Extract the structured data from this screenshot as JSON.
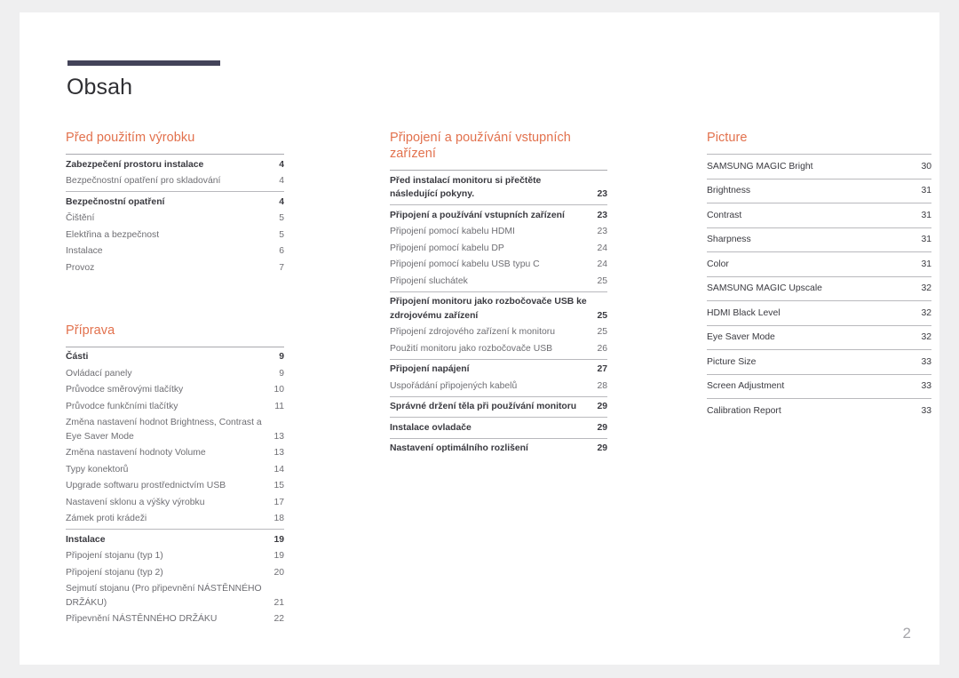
{
  "document": {
    "title": "Obsah",
    "page_number": "2",
    "accent_color": "#e2714d",
    "rule_color": "#434359",
    "page_number_color": "#a6a6ab"
  },
  "columns": [
    {
      "name": "column-1",
      "sections": [
        {
          "title": "Před použitím výrobku",
          "groups": [
            {
              "entries": [
                {
                  "label": "Zabezpečení prostoru instalace",
                  "page": "4",
                  "level": "head"
                },
                {
                  "label": "Bezpečnostní opatření pro skladování",
                  "page": "4",
                  "level": "sub"
                }
              ]
            },
            {
              "entries": [
                {
                  "label": "Bezpečnostní opatření",
                  "page": "4",
                  "level": "head"
                },
                {
                  "label": "Čištění",
                  "page": "5",
                  "level": "sub"
                },
                {
                  "label": "Elektřina a bezpečnost",
                  "page": "5",
                  "level": "sub"
                },
                {
                  "label": "Instalace",
                  "page": "6",
                  "level": "sub"
                },
                {
                  "label": "Provoz",
                  "page": "7",
                  "level": "sub"
                }
              ]
            }
          ]
        },
        {
          "title": "Příprava",
          "groups": [
            {
              "entries": [
                {
                  "label": "Části",
                  "page": "9",
                  "level": "head"
                },
                {
                  "label": "Ovládací panely",
                  "page": "9",
                  "level": "sub"
                },
                {
                  "label": "Průvodce směrovými tlačítky",
                  "page": "10",
                  "level": "sub"
                },
                {
                  "label": "Průvodce funkčními tlačítky",
                  "page": "11",
                  "level": "sub"
                },
                {
                  "label": "Změna nastavení hodnot Brightness, Contrast a Eye Saver Mode",
                  "page": "13",
                  "level": "sub"
                },
                {
                  "label": "Změna nastavení hodnoty Volume",
                  "page": "13",
                  "level": "sub"
                },
                {
                  "label": "Typy konektorů",
                  "page": "14",
                  "level": "sub"
                },
                {
                  "label": "Upgrade softwaru prostřednictvím USB",
                  "page": "15",
                  "level": "sub"
                },
                {
                  "label": "Nastavení sklonu a výšky výrobku",
                  "page": "17",
                  "level": "sub"
                },
                {
                  "label": "Zámek proti krádeži",
                  "page": "18",
                  "level": "sub"
                }
              ]
            },
            {
              "entries": [
                {
                  "label": "Instalace",
                  "page": "19",
                  "level": "head"
                },
                {
                  "label": "Připojení stojanu (typ 1)",
                  "page": "19",
                  "level": "sub"
                },
                {
                  "label": "Připojení stojanu (typ 2)",
                  "page": "20",
                  "level": "sub"
                },
                {
                  "label": "Sejmutí stojanu (Pro připevnění NÁSTĚNNÉHO DRŽÁKU)",
                  "page": "21",
                  "level": "sub"
                },
                {
                  "label": "Připevnění NÁSTĚNNÉHO DRŽÁKU",
                  "page": "22",
                  "level": "sub"
                }
              ]
            }
          ]
        }
      ]
    },
    {
      "name": "column-2",
      "sections": [
        {
          "title": "Připojení a používání vstupních zařízení",
          "groups": [
            {
              "entries": [
                {
                  "label": "Před instalací monitoru si přečtěte následující pokyny.",
                  "page": "23",
                  "level": "head"
                }
              ]
            },
            {
              "entries": [
                {
                  "label": "Připojení a používání vstupních zařízení",
                  "page": "23",
                  "level": "head"
                },
                {
                  "label": "Připojení pomocí kabelu HDMI",
                  "page": "23",
                  "level": "sub"
                },
                {
                  "label": "Připojení pomocí kabelu DP",
                  "page": "24",
                  "level": "sub"
                },
                {
                  "label": "Připojení pomocí kabelu USB typu C",
                  "page": "24",
                  "level": "sub"
                },
                {
                  "label": "Připojení sluchátek",
                  "page": "25",
                  "level": "sub"
                }
              ]
            },
            {
              "entries": [
                {
                  "label": "Připojení monitoru jako rozbočovače USB ke zdrojovému zařízení",
                  "page": "25",
                  "level": "head"
                },
                {
                  "label": "Připojení zdrojového zařízení k monitoru",
                  "page": "25",
                  "level": "sub"
                },
                {
                  "label": "Použití monitoru jako rozbočovače USB",
                  "page": "26",
                  "level": "sub"
                }
              ]
            },
            {
              "entries": [
                {
                  "label": "Připojení napájení",
                  "page": "27",
                  "level": "head"
                },
                {
                  "label": "Uspořádání připojených kabelů",
                  "page": "28",
                  "level": "sub"
                }
              ]
            },
            {
              "entries": [
                {
                  "label": "Správné držení těla při používání monitoru",
                  "page": "29",
                  "level": "head"
                }
              ]
            },
            {
              "entries": [
                {
                  "label": "Instalace ovladače",
                  "page": "29",
                  "level": "head"
                }
              ]
            },
            {
              "entries": [
                {
                  "label": "Nastavení optimálního rozlišení",
                  "page": "29",
                  "level": "head"
                }
              ]
            }
          ]
        }
      ]
    },
    {
      "name": "column-3",
      "sections": [
        {
          "title": "Picture",
          "bands": [
            {
              "label": "SAMSUNG MAGIC Bright",
              "page": "30"
            },
            {
              "label": "Brightness",
              "page": "31"
            },
            {
              "label": "Contrast",
              "page": "31"
            },
            {
              "label": "Sharpness",
              "page": "31"
            },
            {
              "label": "Color",
              "page": "31"
            },
            {
              "label": "SAMSUNG MAGIC Upscale",
              "page": "32"
            },
            {
              "label": "HDMI Black Level",
              "page": "32"
            },
            {
              "label": "Eye Saver Mode",
              "page": "32"
            },
            {
              "label": "Picture Size",
              "page": "33"
            },
            {
              "label": "Screen Adjustment",
              "page": "33"
            },
            {
              "label": "Calibration Report",
              "page": "33"
            }
          ]
        }
      ]
    }
  ]
}
